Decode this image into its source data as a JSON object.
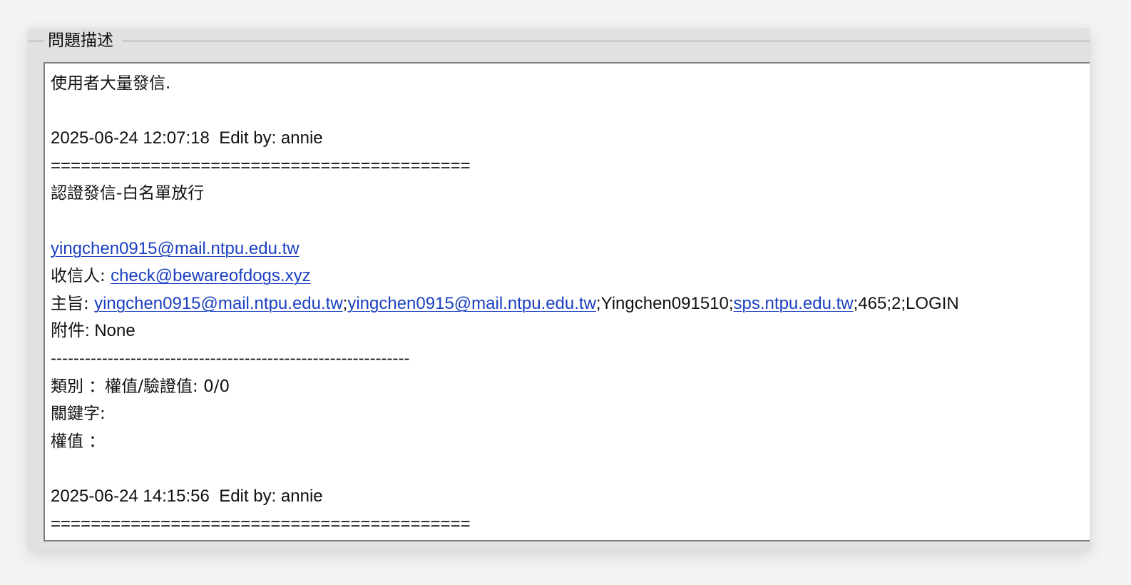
{
  "fieldset": {
    "legend": "問題描述"
  },
  "description": {
    "line1": "使用者大量發信.",
    "entry1": {
      "timestamp": "2025-06-24 12:07:18  Edit by: annie",
      "separator": "==========================================",
      "title": "認證發信-白名單放行",
      "sender_email": "yingchen0915@mail.ntpu.edu.tw",
      "recipient_label": "收信人: ",
      "recipient_email": "check@bewareofdogs.xyz",
      "subject_label": "主旨: ",
      "subject_link1": "yingchen0915@mail.ntpu.edu.tw",
      "subject_sep1": ";",
      "subject_link2": "yingchen0915@mail.ntpu.edu.tw",
      "subject_text1": ";Yingchen091510;",
      "subject_link3": "sps.ntpu.edu.tw",
      "subject_text2": ";465;2;LOGIN",
      "attachment": "附件: None",
      "dash_separator": "---------------------------------------------------------------",
      "category": "類別 ：權值/驗證值: 0/0",
      "keywords": "關鍵字:",
      "weight": "權值 ："
    },
    "entry2": {
      "timestamp": "2025-06-24 14:15:56  Edit by: annie",
      "separator": "=========================================="
    }
  }
}
